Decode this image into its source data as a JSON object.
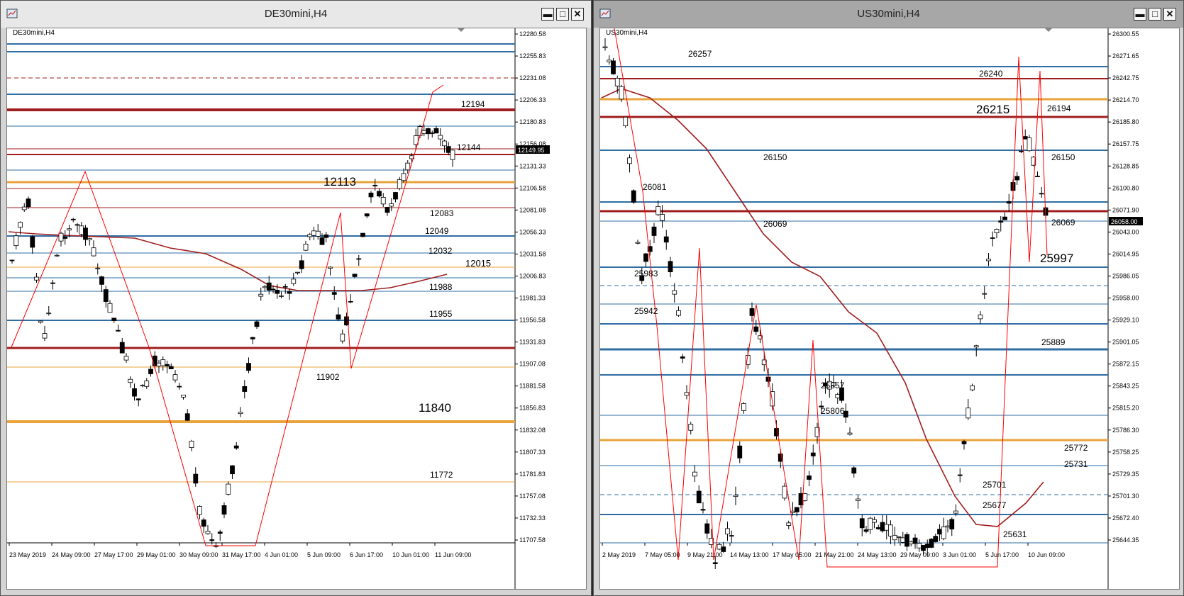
{
  "left_window": {
    "title": "DE30mini,H4",
    "symbol_label": "DE30mini,H4",
    "price_ticks": [
      "12280.58",
      "12255.83",
      "12231.08",
      "12206.33",
      "12180.83",
      "12156.08",
      "12131.33",
      "12106.58",
      "12081.08",
      "12056.33",
      "12031.58",
      "12006.83",
      "11981.33",
      "11956.58",
      "11931.83",
      "11907.08",
      "11881.58",
      "11856.83",
      "11832.08",
      "11807.33",
      "11781.83",
      "11757.08",
      "11732.33",
      "11707.58"
    ],
    "current_price": "12149.95",
    "date_ticks": [
      "23 May 2019",
      "24 May 09:00",
      "27 May 17:00",
      "29 May 01:00",
      "30 May 09:00",
      "31 May 17:00",
      "4 Jun 01:00",
      "5 Jun 09:00",
      "6 Jun 17:00",
      "10 Jun 01:00",
      "11 Jun 09:00"
    ],
    "level_labels": [
      {
        "text": "12194",
        "size": "normal"
      },
      {
        "text": "12144",
        "size": "normal"
      },
      {
        "text": "12113",
        "size": "big"
      },
      {
        "text": "12083",
        "size": "normal"
      },
      {
        "text": "12049",
        "size": "normal"
      },
      {
        "text": "12032",
        "size": "normal"
      },
      {
        "text": "12015",
        "size": "medium"
      },
      {
        "text": "11988",
        "size": "normal"
      },
      {
        "text": "11955",
        "size": "normal"
      },
      {
        "text": "11902",
        "size": "normal"
      },
      {
        "text": "11840",
        "size": "big"
      },
      {
        "text": "11772",
        "size": "normal"
      }
    ]
  },
  "right_window": {
    "title": "US30mini,H4",
    "symbol_label": "US30mini,H4",
    "price_ticks": [
      "26300.55",
      "26271.65",
      "26242.75",
      "26214.70",
      "26185.80",
      "26157.75",
      "26128.85",
      "26100.80",
      "26071.90",
      "26043.00",
      "26014.95",
      "25986.05",
      "25958.00",
      "25929.10",
      "25901.05",
      "25872.15",
      "25843.25",
      "25815.20",
      "25786.30",
      "25758.25",
      "25729.35",
      "25701.30",
      "25672.40",
      "25644.35"
    ],
    "current_price": "26058.00",
    "date_ticks": [
      "2 May 2019",
      "7 May 05:00",
      "9 May 21:00",
      "14 May 13:00",
      "17 May 05:00",
      "21 May 21:00",
      "24 May 13:00",
      "29 May 09:00",
      "3 Jun 01:00",
      "5 Jun 17:00",
      "10 Jun 09:00"
    ],
    "level_labels": [
      {
        "text": "26257",
        "size": "normal"
      },
      {
        "text": "26240",
        "size": "normal"
      },
      {
        "text": "26215",
        "size": "big"
      },
      {
        "text": "26194",
        "size": "normal"
      },
      {
        "text": "26150",
        "size": "normal"
      },
      {
        "text": "26150",
        "size": "normal"
      },
      {
        "text": "26081",
        "size": "normal"
      },
      {
        "text": "26069",
        "size": "normal"
      },
      {
        "text": "26069",
        "size": "normal"
      },
      {
        "text": "25997",
        "size": "big"
      },
      {
        "text": "25983",
        "size": "normal"
      },
      {
        "text": "25942",
        "size": "normal"
      },
      {
        "text": "25889",
        "size": "normal"
      },
      {
        "text": "25857",
        "size": "normal"
      },
      {
        "text": "25806",
        "size": "normal"
      },
      {
        "text": "25772",
        "size": "normal"
      },
      {
        "text": "25731",
        "size": "normal"
      },
      {
        "text": "25701",
        "size": "normal"
      },
      {
        "text": "25677",
        "size": "normal"
      },
      {
        "text": "25631",
        "size": "normal"
      }
    ]
  },
  "colors": {
    "bull": "#ffffff",
    "bear": "#000000",
    "blue_level": "#2f6da3",
    "red_level": "#a01d1d",
    "orange_level": "#e8a33a",
    "zigzag": "#ff0000",
    "ma": "#a01d1d",
    "green_level": "#2e8b3e"
  }
}
